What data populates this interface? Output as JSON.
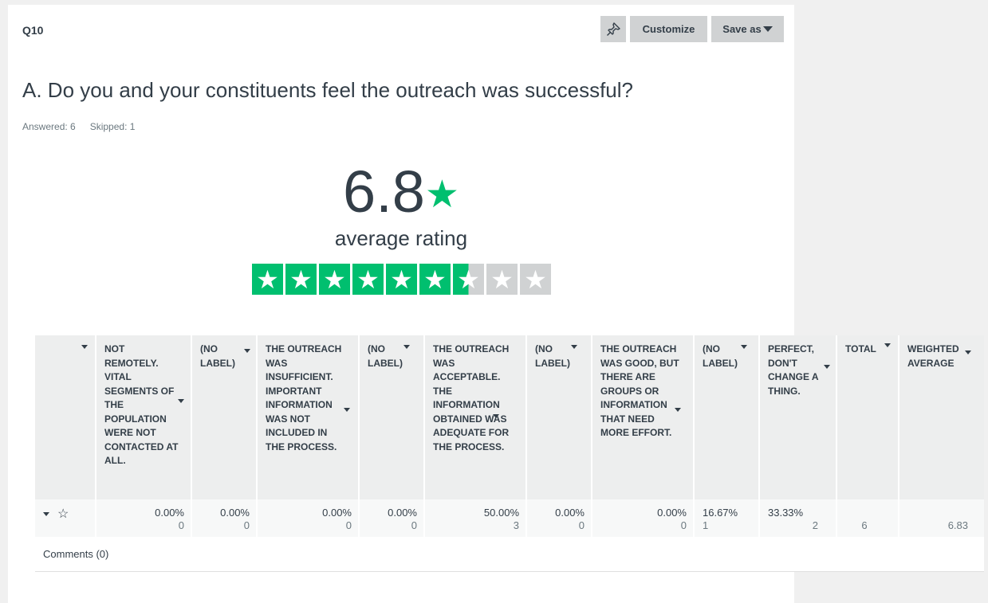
{
  "question": {
    "label": "Q10",
    "title": "A. Do you and your constituents feel the outreach was successful?",
    "answered": "Answered: 6",
    "skipped": "Skipped: 1"
  },
  "toolbar": {
    "pin_icon": "pin-icon",
    "customize_label": "Customize",
    "save_as_label": "Save as"
  },
  "rating": {
    "average": "6.8",
    "label": "average rating",
    "star_count": 9,
    "filled_fraction": 0.756,
    "accent_color": "#00bf6f"
  },
  "table": {
    "headers": [
      "",
      "NOT REMOTELY. VITAL SEGMENTS OF THE POPULATION WERE NOT CONTACTED AT ALL.",
      "(NO LABEL)",
      "THE OUTREACH WAS INSUFFICIENT. IMPORTANT INFORMATION WAS NOT INCLUDED IN THE PROCESS.",
      "(NO LABEL)",
      "THE OUTREACH WAS ACCEPTABLE. THE INFORMATION OBTAINED WAS ADEQUATE FOR THE PROCESS.",
      "(NO LABEL)",
      "THE OUTREACH WAS GOOD, BUT THERE ARE GROUPS OR INFORMATION THAT NEED MORE EFFORT.",
      "(NO LABEL)",
      "PERFECT, DON'T CHANGE A THING.",
      "TOTAL",
      "WEIGHTED AVERAGE"
    ],
    "row": {
      "cells": [
        {
          "pct": "0.00%",
          "count": "0"
        },
        {
          "pct": "0.00%",
          "count": "0"
        },
        {
          "pct": "0.00%",
          "count": "0"
        },
        {
          "pct": "0.00%",
          "count": "0"
        },
        {
          "pct": "50.00%",
          "count": "3"
        },
        {
          "pct": "0.00%",
          "count": "0"
        },
        {
          "pct": "0.00%",
          "count": "0"
        },
        {
          "pct": "16.67%",
          "count": "1"
        },
        {
          "pct": "33.33%",
          "count": "2"
        }
      ],
      "total": "6",
      "weighted_average": "6.83"
    },
    "comments": "Comments (0)"
  }
}
